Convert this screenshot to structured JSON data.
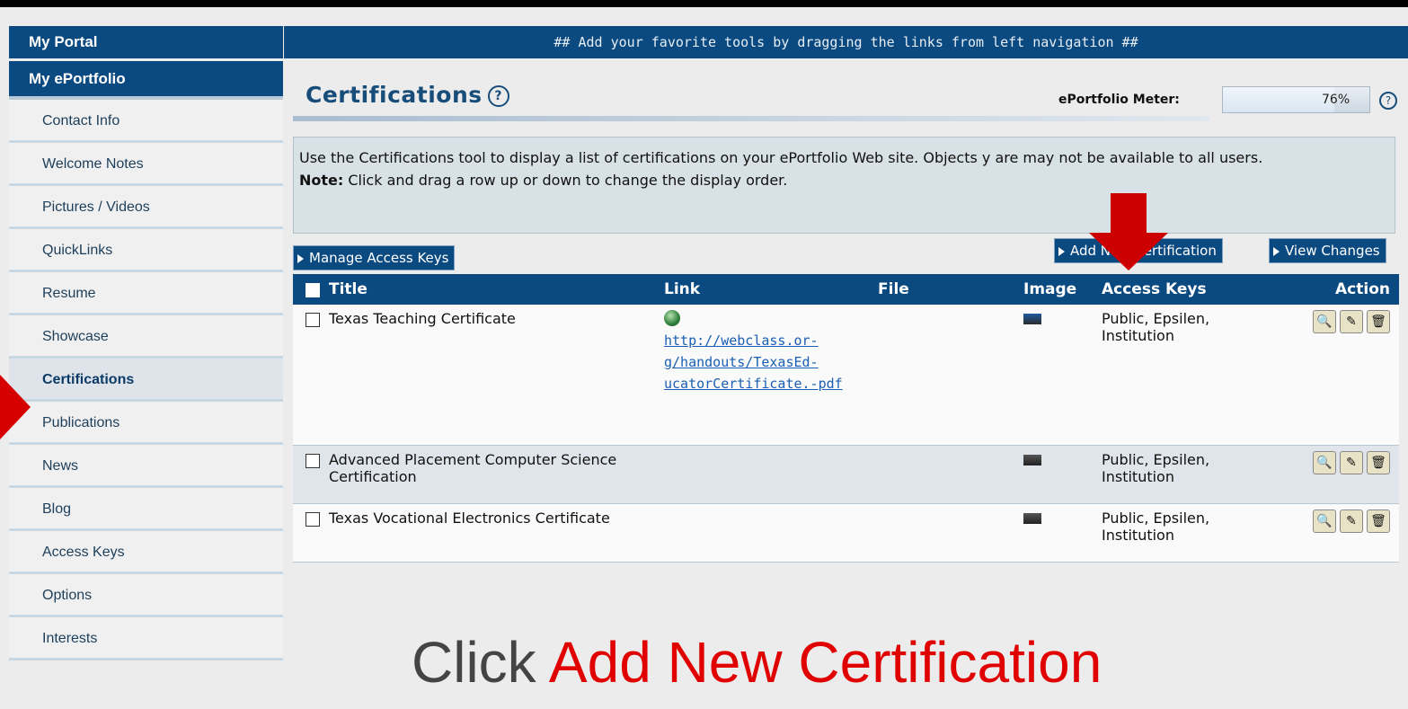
{
  "sidebar": {
    "my_portal": "My Portal",
    "my_eportfolio": "My ePortfolio",
    "items": [
      {
        "label": "Contact Info"
      },
      {
        "label": "Welcome Notes"
      },
      {
        "label": "Pictures / Videos"
      },
      {
        "label": "QuickLinks"
      },
      {
        "label": "Resume"
      },
      {
        "label": "Showcase"
      },
      {
        "label": "Certifications",
        "active": true
      },
      {
        "label": "Publications"
      },
      {
        "label": "News"
      },
      {
        "label": "Blog"
      },
      {
        "label": "Access Keys"
      },
      {
        "label": "Options"
      },
      {
        "label": "Interests"
      }
    ]
  },
  "banner": "## Add your favorite tools by dragging the links from left navigation ##",
  "page": {
    "title": "Certifications",
    "help": "?",
    "meter_label": "ePortfolio Meter:",
    "meter_value": "76%",
    "meter_fraction": 0.76
  },
  "info": {
    "line1": "Use the Certifications tool to display a list of certifications on your ePortfolio Web site. Objects y    are may not be available to all users.",
    "note_label": "Note:",
    "note_text": " Click and drag a row up or down to change the display order."
  },
  "buttons": {
    "manage": "Manage Access Keys",
    "add_new": "Add New Certification",
    "view_changes": "View Changes"
  },
  "table": {
    "headers": {
      "title": "Title",
      "link": "Link",
      "file": "File",
      "image": "Image",
      "access": "Access Keys",
      "action": "Action"
    },
    "rows": [
      {
        "title": "Texas Teaching Certificate",
        "link": "http://webclass.or-g/handouts/TexasEd-ucatorCertificate.-pdf",
        "access": "Public, Epsilen, Institution"
      },
      {
        "title": "Advanced Placement Computer Science Certification",
        "link": "",
        "access": "Public, Epsilen, Institution"
      },
      {
        "title": "Texas Vocational Electronics Certificate",
        "link": "",
        "access": "Public, Epsilen, Institution"
      }
    ]
  },
  "caption": {
    "plain": "Click ",
    "highlight": "Add New Certification"
  },
  "colors": {
    "nav_blue": "#0b4a80",
    "arrow_red": "#cc0000",
    "caption_red": "#e00000"
  }
}
